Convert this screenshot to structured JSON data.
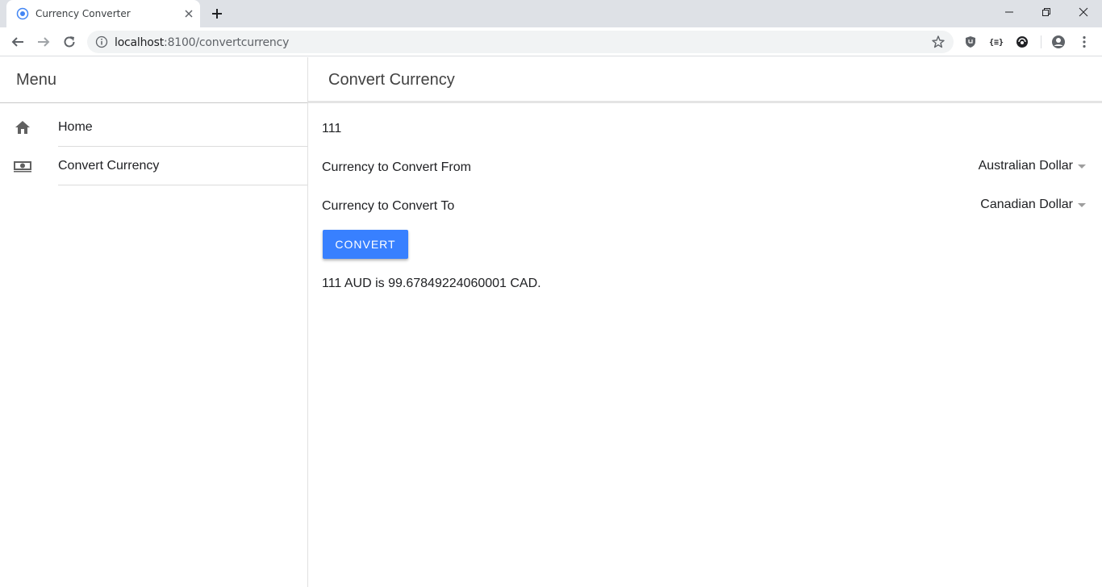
{
  "browser": {
    "tab_title": "Currency Converter",
    "url_host": "localhost",
    "url_path": ":8100/convertcurrency"
  },
  "menu": {
    "title": "Menu",
    "items": [
      {
        "label": "Home",
        "icon": "home-icon"
      },
      {
        "label": "Convert Currency",
        "icon": "cash-icon"
      }
    ]
  },
  "page": {
    "title": "Convert Currency",
    "amount_value": "111",
    "from": {
      "label": "Currency to Convert From",
      "selected": "Australian Dollar"
    },
    "to": {
      "label": "Currency to Convert To",
      "selected": "Canadian Dollar"
    },
    "convert_label": "CONVERT",
    "result": "111 AUD is 99.67849224060001 CAD."
  },
  "colors": {
    "accent": "#3880ff",
    "chrome": "#dee1e6"
  }
}
